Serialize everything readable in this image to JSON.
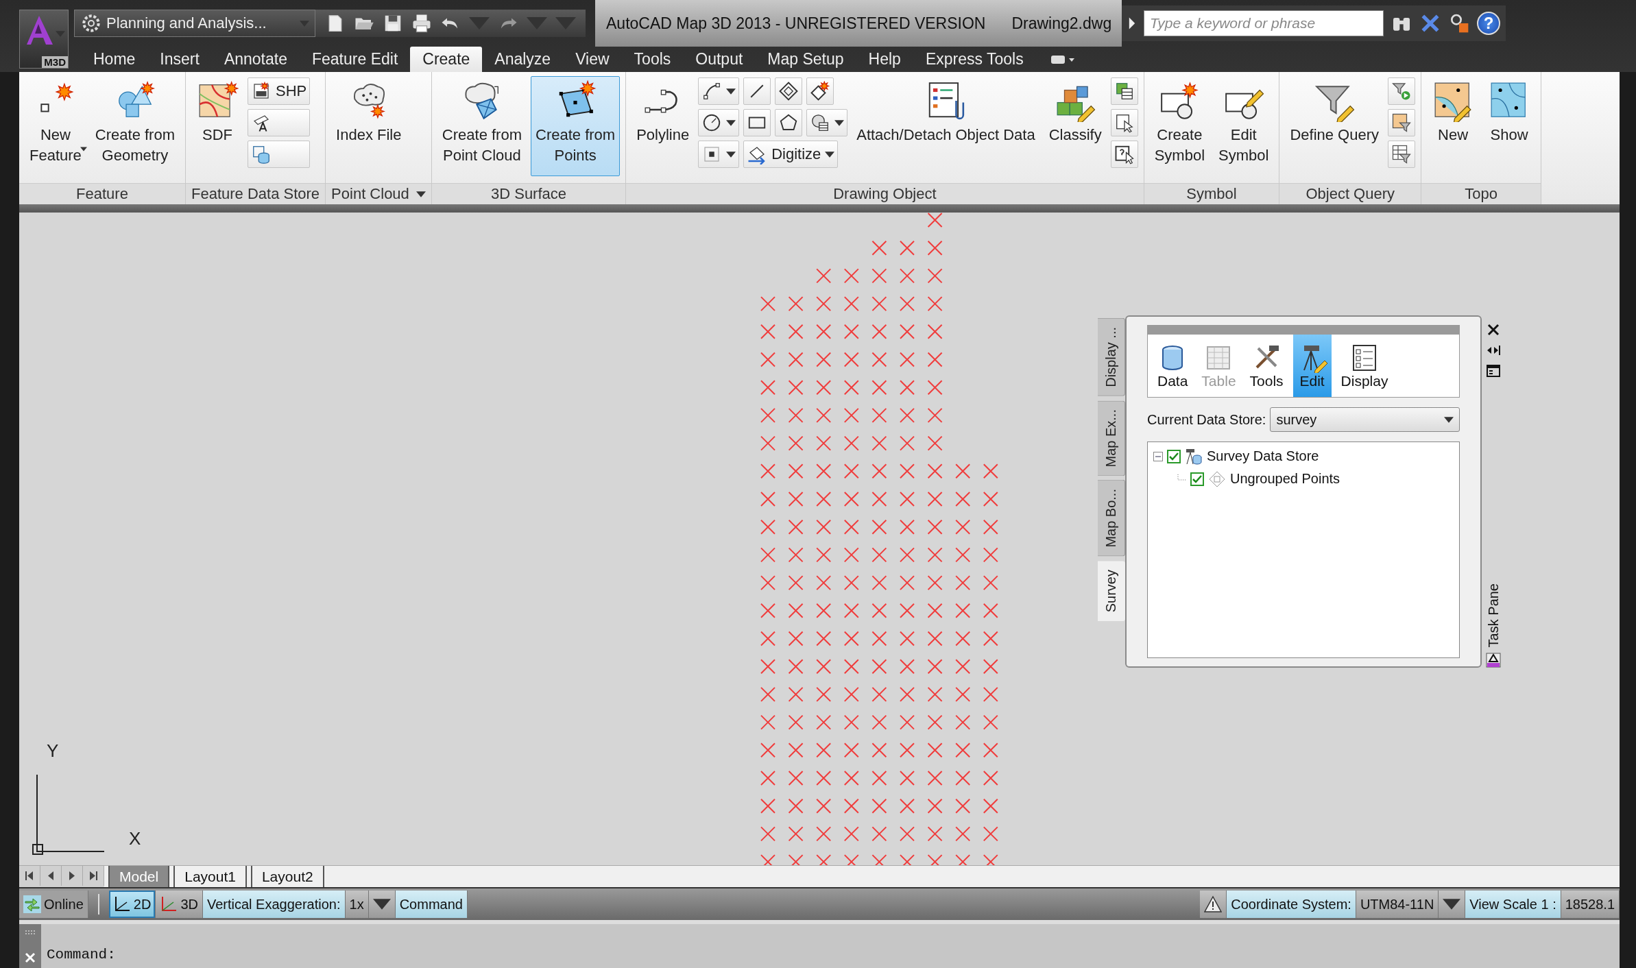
{
  "app_menu": {
    "label": "M3D"
  },
  "workspace": {
    "value": "Planning and Analysis..."
  },
  "title": {
    "text": "AutoCAD Map 3D 2013 - UNREGISTERED VERSION",
    "file": "Drawing2.dwg"
  },
  "search": {
    "placeholder": "Type a keyword or phrase"
  },
  "help": {
    "label": "?"
  },
  "ribbon_tabs": [
    {
      "label": "Home",
      "selected": false
    },
    {
      "label": "Insert",
      "selected": false
    },
    {
      "label": "Annotate",
      "selected": false
    },
    {
      "label": "Feature Edit",
      "selected": false
    },
    {
      "label": "Create",
      "selected": true
    },
    {
      "label": "Analyze",
      "selected": false
    },
    {
      "label": "View",
      "selected": false
    },
    {
      "label": "Tools",
      "selected": false
    },
    {
      "label": "Output",
      "selected": false
    },
    {
      "label": "Map Setup",
      "selected": false
    },
    {
      "label": "Help",
      "selected": false
    },
    {
      "label": "Express Tools",
      "selected": false
    }
  ],
  "ribbon_panels": [
    {
      "title": "Feature",
      "menu": false,
      "items": [
        {
          "kind": "large",
          "label": "New\nFeature",
          "dropdown": true,
          "selected": false
        },
        {
          "kind": "large",
          "label": "Create from\nGeometry",
          "dropdown": false,
          "selected": false
        }
      ]
    },
    {
      "title": "Feature Data Store",
      "menu": false,
      "items": [
        {
          "kind": "large",
          "label": "SDF",
          "dropdown": false,
          "selected": false
        },
        {
          "kind": "stack",
          "tools": [
            {
              "label": "SHP",
              "dropdown": false
            },
            {
              "dropdown": false
            },
            {
              "dropdown": false
            }
          ]
        }
      ]
    },
    {
      "title": "Point Cloud",
      "menu": true,
      "items": [
        {
          "kind": "large",
          "label": "Index File",
          "dropdown": false,
          "selected": false
        }
      ]
    },
    {
      "title": "3D Surface",
      "menu": false,
      "items": [
        {
          "kind": "large",
          "label": "Create from\nPoint Cloud",
          "dropdown": false,
          "selected": false
        },
        {
          "kind": "large",
          "label": "Create from\nPoints",
          "dropdown": false,
          "selected": true
        }
      ]
    },
    {
      "title": "Drawing Object",
      "menu": false,
      "items": [
        {
          "kind": "large",
          "label": "Polyline",
          "dropdown": false,
          "selected": false
        },
        {
          "kind": "grid",
          "rows": [
            [
              {
                "dropdown": true
              },
              {
                "dropdown": false
              },
              {
                "dropdown": false
              },
              {
                "dropdown": false
              }
            ],
            [
              {
                "dropdown": true
              },
              {
                "dropdown": false
              },
              {
                "dropdown": false
              },
              {
                "dropdown": true
              }
            ],
            [
              {
                "dropdown": true
              },
              {
                "label": "Digitize",
                "dropdown": true
              }
            ]
          ]
        },
        {
          "kind": "large",
          "label": "Attach/Detach Object Data",
          "dropdown": false,
          "selected": false
        },
        {
          "kind": "large",
          "label": "Classify",
          "dropdown": false,
          "selected": false
        },
        {
          "kind": "stack",
          "tools": [
            {
              "dropdown": false
            },
            {
              "dropdown": false
            },
            {
              "dropdown": false
            }
          ]
        }
      ]
    },
    {
      "title": "Symbol",
      "menu": false,
      "items": [
        {
          "kind": "large",
          "label": "Create\nSymbol",
          "dropdown": false,
          "selected": false
        },
        {
          "kind": "large",
          "label": "Edit\nSymbol",
          "dropdown": false,
          "selected": false
        }
      ]
    },
    {
      "title": "Object Query",
      "menu": false,
      "items": [
        {
          "kind": "large",
          "label": "Define Query",
          "dropdown": false,
          "selected": false
        },
        {
          "kind": "stack",
          "tools": [
            {
              "dropdown": false
            },
            {
              "dropdown": false
            },
            {
              "dropdown": false
            }
          ]
        }
      ]
    },
    {
      "title": "Topo",
      "menu": false,
      "items": [
        {
          "kind": "large",
          "label": "New",
          "dropdown": false,
          "selected": false
        },
        {
          "kind": "large",
          "label": "Show",
          "dropdown": false,
          "selected": false
        }
      ]
    }
  ],
  "ucs": {
    "x_label": "X",
    "y_label": "Y"
  },
  "task_pane": {
    "title": "Task Pane",
    "side_tabs": [
      {
        "label": "Display ...",
        "selected": false
      },
      {
        "label": "Map Ex...",
        "selected": false
      },
      {
        "label": "Map Bo...",
        "selected": false
      },
      {
        "label": "Survey",
        "selected": true
      }
    ],
    "toolbar": [
      {
        "label": "Data",
        "selected": false,
        "disabled": false
      },
      {
        "label": "Table",
        "selected": false,
        "disabled": true
      },
      {
        "label": "Tools",
        "selected": false,
        "disabled": false
      },
      {
        "label": "Edit",
        "selected": true,
        "disabled": false
      },
      {
        "label": "Display",
        "selected": false,
        "disabled": false
      }
    ],
    "data_store": {
      "label": "Current Data Store:",
      "value": "survey"
    },
    "tree": [
      {
        "label": "Survey Data Store",
        "checked": true,
        "expanded": true,
        "children": [
          {
            "label": "Ungrouped Points",
            "checked": true
          }
        ]
      }
    ]
  },
  "layout_tabs": [
    {
      "label": "Model",
      "selected": true
    },
    {
      "label": "Layout1",
      "selected": false
    },
    {
      "label": "Layout2",
      "selected": false
    }
  ],
  "status_left": [
    {
      "kind": "online",
      "text": "Online"
    },
    {
      "kind": "separator"
    },
    {
      "kind": "toggle",
      "text": "2D",
      "selected": true
    },
    {
      "kind": "toggle",
      "text": "3D",
      "selected": false
    },
    {
      "kind": "label",
      "text": "Vertical Exaggeration:"
    },
    {
      "kind": "value",
      "text": "1x"
    },
    {
      "kind": "dropdown"
    },
    {
      "kind": "label",
      "text": "Command"
    }
  ],
  "status_right": [
    {
      "kind": "warning"
    },
    {
      "kind": "label",
      "text": "Coordinate System:"
    },
    {
      "kind": "value",
      "text": "UTM84-11N"
    },
    {
      "kind": "dropdown"
    },
    {
      "kind": "label",
      "text": "View Scale   1 :"
    },
    {
      "kind": "value",
      "text": "18528.1"
    }
  ],
  "command_line": {
    "prompt": "Command:"
  }
}
